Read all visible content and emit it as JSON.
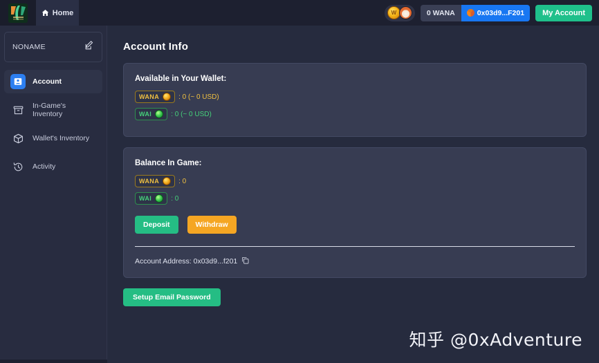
{
  "topbar": {
    "logo_icon": "wanaka-leaf-logo",
    "home_tab": {
      "label": "Home",
      "icon": "home-icon"
    },
    "avatar_pill": {
      "coin_icon": "gold-coin-avatar",
      "fox_icon": "fox-avatar"
    },
    "wallet_balance": "0 WANA",
    "wallet_address": "0x03d9...F201",
    "wallet_address_icon": "metamask-fox-icon",
    "my_account_label": "My Account"
  },
  "sidebar": {
    "profile_name": "NONAME",
    "edit_icon": "edit-pencil-square-icon",
    "items": [
      {
        "label": "Account",
        "icon": "person-card-icon",
        "active": true
      },
      {
        "label": "In-Game's Inventory",
        "icon": "archive-box-icon",
        "active": false
      },
      {
        "label": "Wallet's Inventory",
        "icon": "cube-box-icon",
        "active": false
      },
      {
        "label": "Activity",
        "icon": "clock-history-icon",
        "active": false
      }
    ]
  },
  "main": {
    "page_title": "Account Info",
    "wallet_card": {
      "heading": "Available in Your Wallet:",
      "tokens": [
        {
          "name": "WANA",
          "coin": "gold-coin-icon",
          "value": ": 0 (~ 0 USD)"
        },
        {
          "name": "WAI",
          "coin": "green-coin-icon",
          "value": ": 0 (~ 0 USD)"
        }
      ]
    },
    "game_card": {
      "heading": "Balance In Game:",
      "tokens": [
        {
          "name": "WANA",
          "coin": "gold-coin-icon",
          "value": ": 0"
        },
        {
          "name": "WAI",
          "coin": "green-coin-icon",
          "value": ": 0"
        }
      ],
      "deposit_label": "Deposit",
      "withdraw_label": "Withdraw",
      "address_label": "Account Address: 0x03d9...f201",
      "copy_icon": "copy-icon"
    },
    "setup_email_label": "Setup Email Password"
  },
  "watermark": "知乎 @0xAdventure",
  "colors": {
    "page_bg": "#262b3e",
    "sidebar_bg": "#282c40",
    "topbar_bg": "#1d2030",
    "card_bg": "#373c52",
    "accent_green": "#25bd84",
    "accent_orange": "#f5a623",
    "accent_blue": "#1877f2",
    "token_gold": "#f0c040",
    "token_green": "#45d17a"
  }
}
